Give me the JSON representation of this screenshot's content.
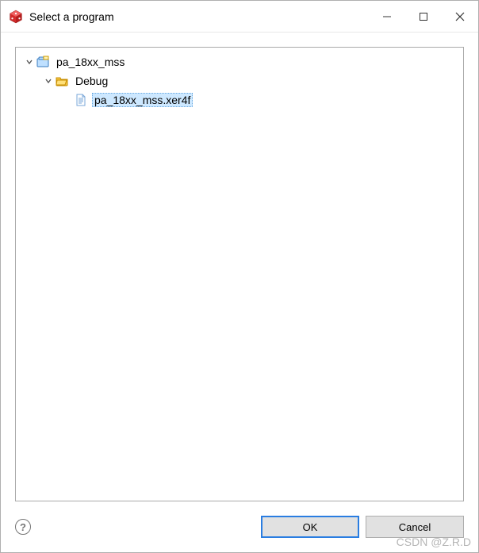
{
  "window": {
    "title": "Select a program"
  },
  "tree": {
    "project": {
      "label": "pa_18xx_mss"
    },
    "folder": {
      "label": "Debug"
    },
    "file": {
      "label": "pa_18xx_mss.xer4f"
    }
  },
  "buttons": {
    "ok": "OK",
    "cancel": "Cancel"
  },
  "help": {
    "glyph": "?"
  },
  "watermark": "CSDN @Z.R.D"
}
